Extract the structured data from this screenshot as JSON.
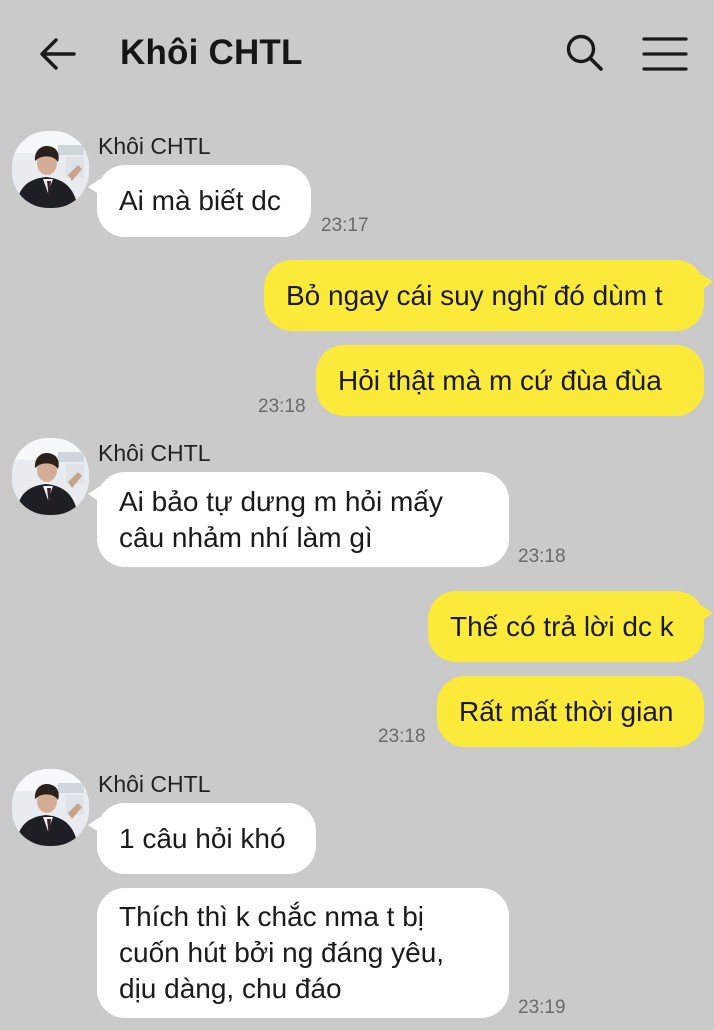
{
  "header": {
    "title": "Khôi CHTL",
    "back_icon": "arrow-left-icon",
    "search_icon": "search-icon",
    "menu_icon": "hamburger-menu-icon"
  },
  "colors": {
    "background": "#cacaca",
    "outgoing_bubble": "#fcea3a",
    "incoming_bubble": "#ffffff",
    "timestamp": "#6a6a6a"
  },
  "messages": [
    {
      "sender": "Khôi CHTL",
      "direction": "in",
      "text": "Ai mà biết dc",
      "time": "23:17"
    },
    {
      "direction": "out",
      "text": "Bỏ ngay cái suy nghĩ đó dùm t"
    },
    {
      "direction": "out",
      "text": "Hỏi thật mà m cứ đùa đùa",
      "time": "23:18"
    },
    {
      "sender": "Khôi CHTL",
      "direction": "in",
      "text": "Ai bảo tự dưng m hỏi mấy\ncâu nhảm nhí làm gì",
      "time": "23:18"
    },
    {
      "direction": "out",
      "text": "Thế có trả lời dc k"
    },
    {
      "direction": "out",
      "text": "Rất mất thời gian",
      "time": "23:18"
    },
    {
      "sender": "Khôi CHTL",
      "direction": "in",
      "text": "1 câu hỏi khó"
    },
    {
      "direction": "in",
      "text": "Thích thì k chắc nma t bị\ncuốn hút bởi ng đáng yêu,\ndịu dàng, chu đáo",
      "time": "23:19"
    }
  ]
}
